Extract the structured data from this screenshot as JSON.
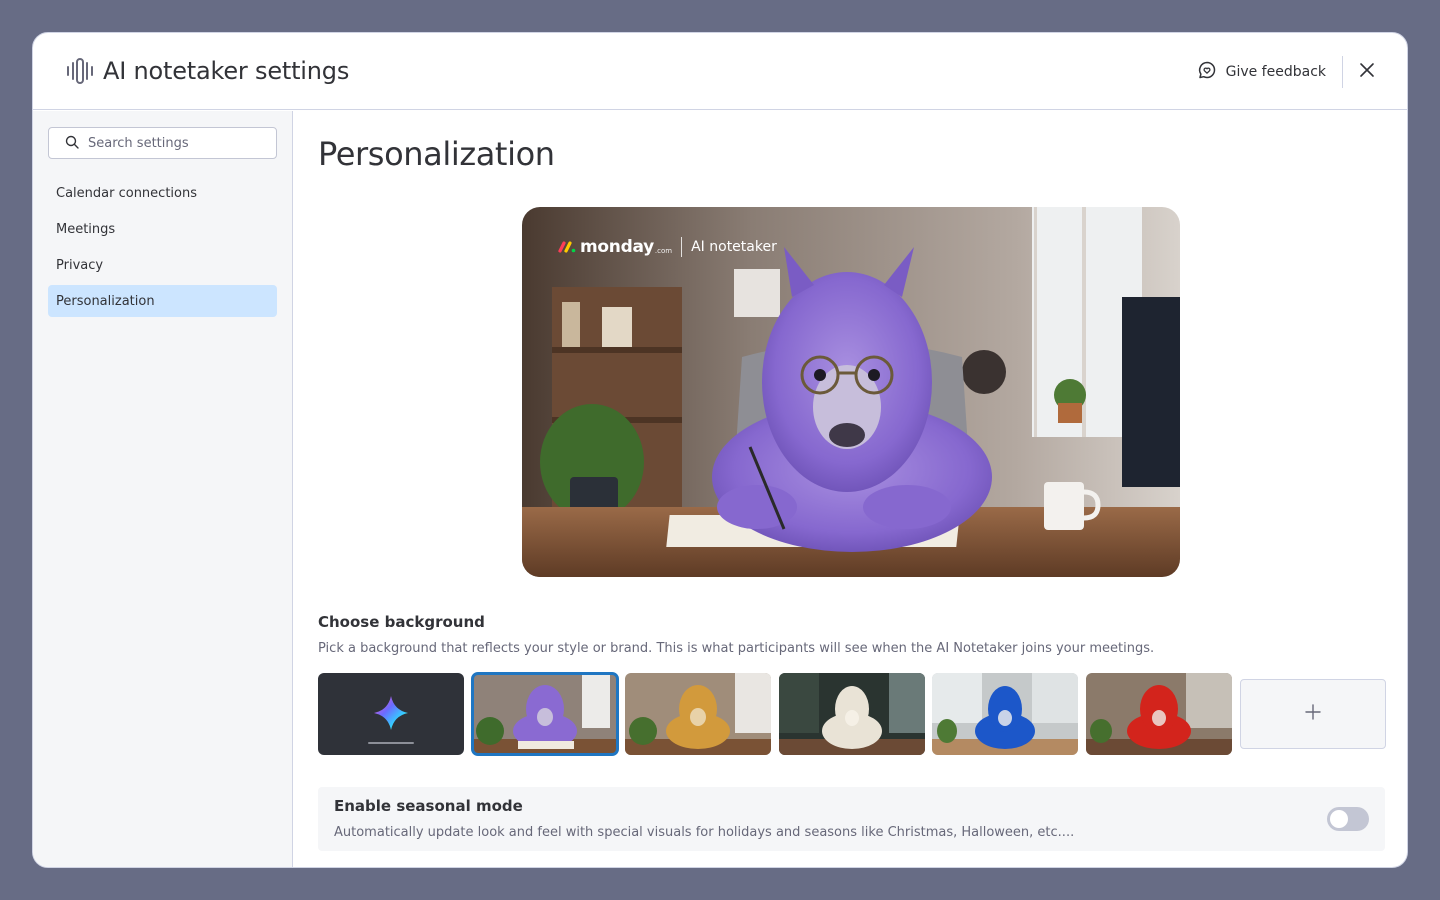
{
  "header": {
    "title": "AI notetaker settings",
    "feedback_label": "Give feedback"
  },
  "sidebar": {
    "search_placeholder": "Search settings",
    "items": [
      {
        "label": "Calendar connections"
      },
      {
        "label": "Meetings"
      },
      {
        "label": "Privacy"
      },
      {
        "label": "Personalization",
        "active": true
      }
    ]
  },
  "main": {
    "page_title": "Personalization",
    "preview": {
      "brand_name": "monday",
      "brand_suffix": ".com",
      "product_name": "AI notetaker"
    },
    "background": {
      "title": "Choose background",
      "description": "Pick a background that reflects your style or brand. This is what participants will see when the AI Notetaker joins your meetings.",
      "options": [
        {
          "name": "sparkle-default",
          "selected": false
        },
        {
          "name": "purple-llama-office",
          "selected": true
        },
        {
          "name": "golden-llama-office",
          "selected": false
        },
        {
          "name": "white-llama-office",
          "selected": false
        },
        {
          "name": "blue-llama-office",
          "selected": false
        },
        {
          "name": "red-llama-office",
          "selected": false
        }
      ],
      "add_icon": "plus-icon"
    },
    "seasonal": {
      "title": "Enable seasonal mode",
      "description": "Automatically update look and feel with special visuals for holidays and seasons like Christmas, Halloween, etc....",
      "enabled": false
    }
  },
  "colors": {
    "accent": "#1f76c2",
    "active_nav": "#cce5ff",
    "overlay": "#676c85"
  }
}
